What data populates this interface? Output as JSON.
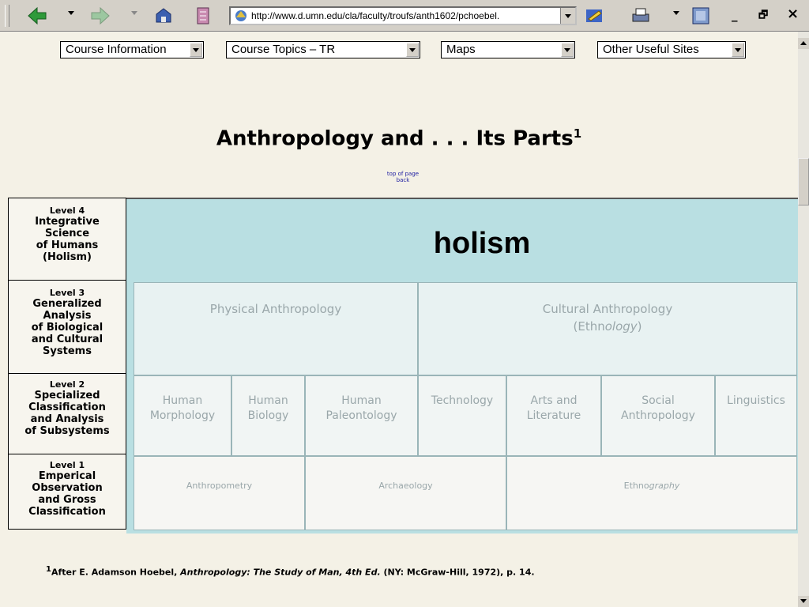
{
  "browser": {
    "url": "http://www.d.umn.edu/cla/faculty/troufs/anth1602/pchoebel.",
    "win_min": "_",
    "win_restore": "🗗",
    "win_close": "×",
    "colors": {
      "toolbar": "#d4d0c8"
    }
  },
  "nav": {
    "selects": [
      {
        "label": "Course Information"
      },
      {
        "label": "Course Topics – TR"
      },
      {
        "label": "Maps"
      },
      {
        "label": "Other Useful Sites"
      }
    ]
  },
  "title": {
    "text": "Anthropology and . . . Its Parts",
    "sup": "1"
  },
  "small_links": {
    "top": "top of page",
    "back": "back"
  },
  "levels": [
    {
      "num": "Level 4",
      "lines": [
        "Integrative",
        "Science",
        "of Humans",
        "(Holism)"
      ]
    },
    {
      "num": "Level 3",
      "lines": [
        "Generalized",
        "Analysis",
        "of Biological",
        "and Cultural",
        "Systems"
      ]
    },
    {
      "num": "Level 2",
      "lines": [
        "Specialized",
        "Classification",
        "and Analysis",
        "of Subsystems"
      ]
    },
    {
      "num": "Level 1",
      "lines": [
        "Emperical",
        "Observation",
        "and Gross",
        "Classification"
      ]
    }
  ],
  "holism": {
    "word": "holism",
    "color": "#b9dfe2"
  },
  "level3_cells": [
    {
      "line1": "Physical Anthropology",
      "line2": ""
    },
    {
      "line1": "Cultural Anthropology",
      "line2a": "(Ethn",
      "line2b": "ology",
      "line2c": ")"
    }
  ],
  "level2_cells": [
    {
      "line1": "Human",
      "line2": "Morphology"
    },
    {
      "line1": "Human",
      "line2": "Biology"
    },
    {
      "line1": "Human",
      "line2": "Paleontology"
    },
    {
      "line1": "Technology",
      "line2": ""
    },
    {
      "line1": "Arts and",
      "line2": "Literature"
    },
    {
      "line1": "Social",
      "line2": "Anthropology"
    },
    {
      "line1": "Linguistics",
      "line2": ""
    }
  ],
  "level1_cells": [
    {
      "text": "Anthropometry"
    },
    {
      "text": "Archaeology"
    },
    {
      "text_a": "Ethno",
      "text_b": "graphy"
    }
  ],
  "footnote": {
    "sup": "1",
    "prefix": "After E. Adamson Hoebel, ",
    "book": "Anthropology: The Study of Man, 4th Ed.",
    "suffix": " (NY: McGraw-Hill, 1972), p. 14."
  }
}
